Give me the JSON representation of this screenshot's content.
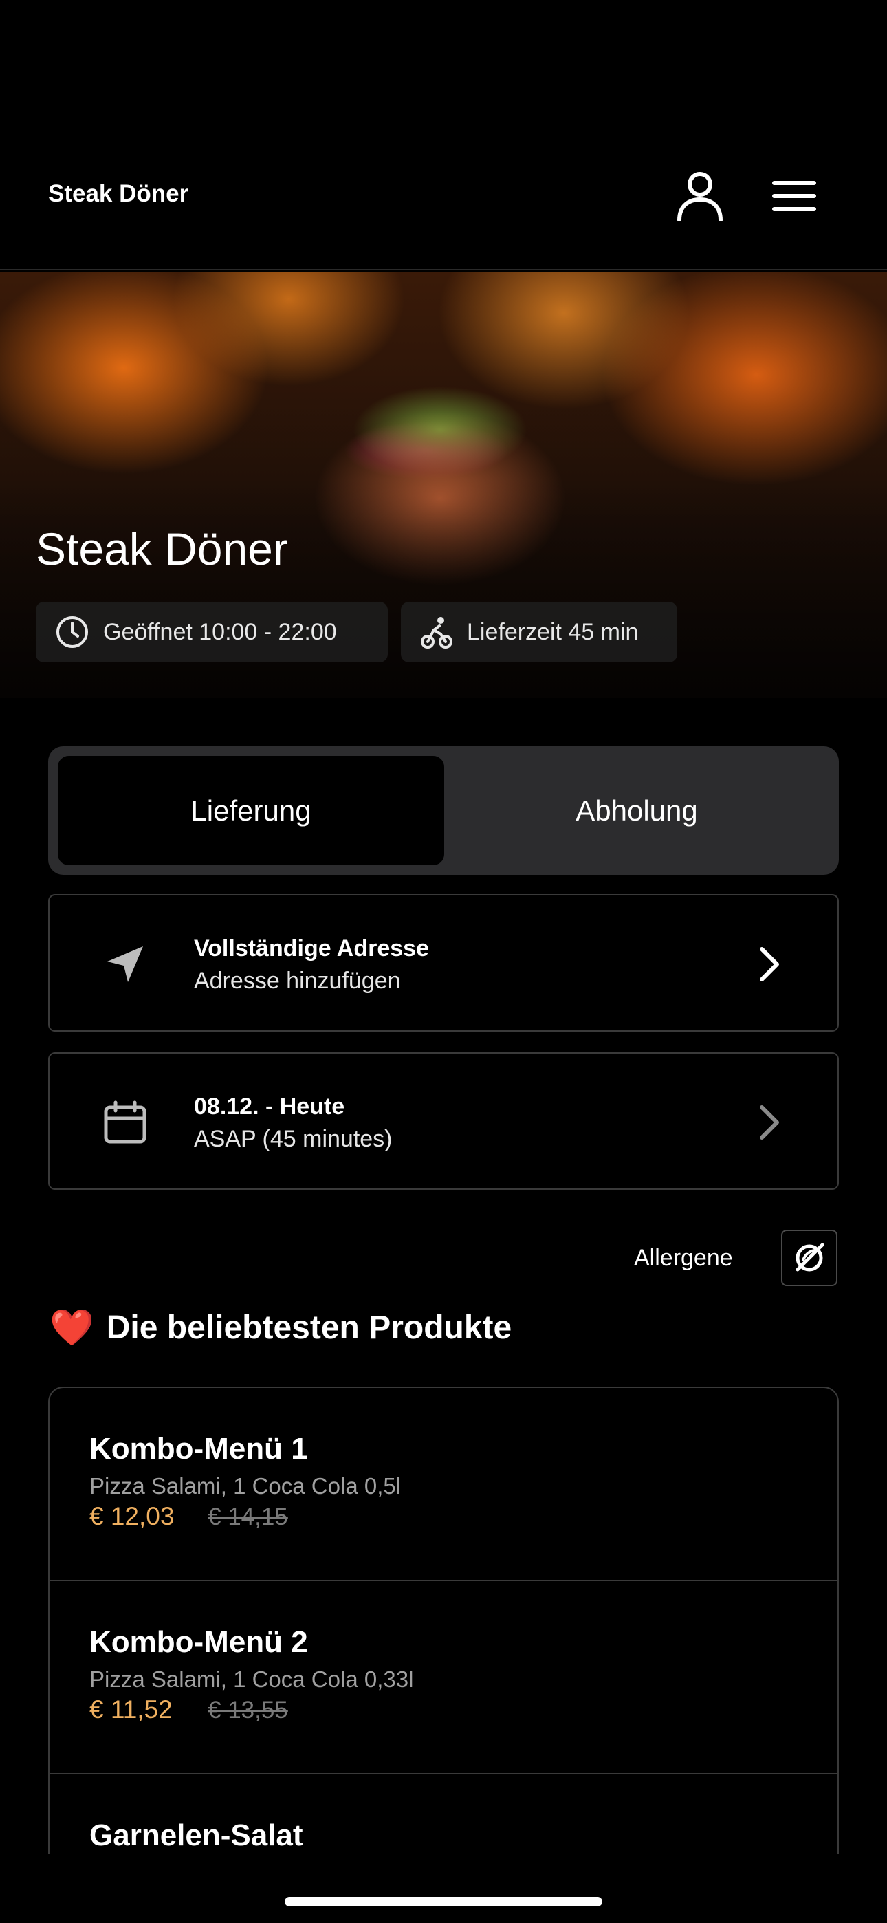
{
  "header": {
    "brand": "Steak Döner"
  },
  "hero": {
    "title": "Steak Döner",
    "opening_hours": "Geöffnet 10:00 - 22:00",
    "delivery_time": "Lieferzeit 45 min"
  },
  "order_mode": {
    "options": [
      "Lieferung",
      "Abholung"
    ],
    "selected": "Lieferung"
  },
  "address_card": {
    "title": "Vollständige Adresse",
    "subtitle": "Adresse hinzufügen"
  },
  "date_card": {
    "title": "08.12. - Heute",
    "subtitle": "ASAP (45 minutes)"
  },
  "allergens": {
    "label": "Allergene"
  },
  "popular": {
    "emoji": "❤️",
    "title": "Die beliebtesten Produkte",
    "products": [
      {
        "name": "Kombo-Menü 1",
        "description": "Pizza Salami, 1 Coca Cola 0,5l",
        "price": "€ 12,03",
        "old_price": "€ 14,15"
      },
      {
        "name": "Kombo-Menü 2",
        "description": "Pizza Salami, 1 Coca Cola 0,33l",
        "price": "€ 11,52",
        "old_price": "€ 13,55"
      },
      {
        "name": "Garnelen-Salat",
        "description": "",
        "price": "",
        "old_price": ""
      }
    ]
  },
  "colors": {
    "accent_price": "#f0b060",
    "background": "#000000",
    "segment_bg": "#2c2c2e"
  },
  "icons": [
    "user-icon",
    "menu-icon",
    "clock-icon",
    "bike-icon",
    "location-arrow-icon",
    "calendar-icon",
    "chevron-right-icon",
    "allergen-icon",
    "heart-icon"
  ]
}
